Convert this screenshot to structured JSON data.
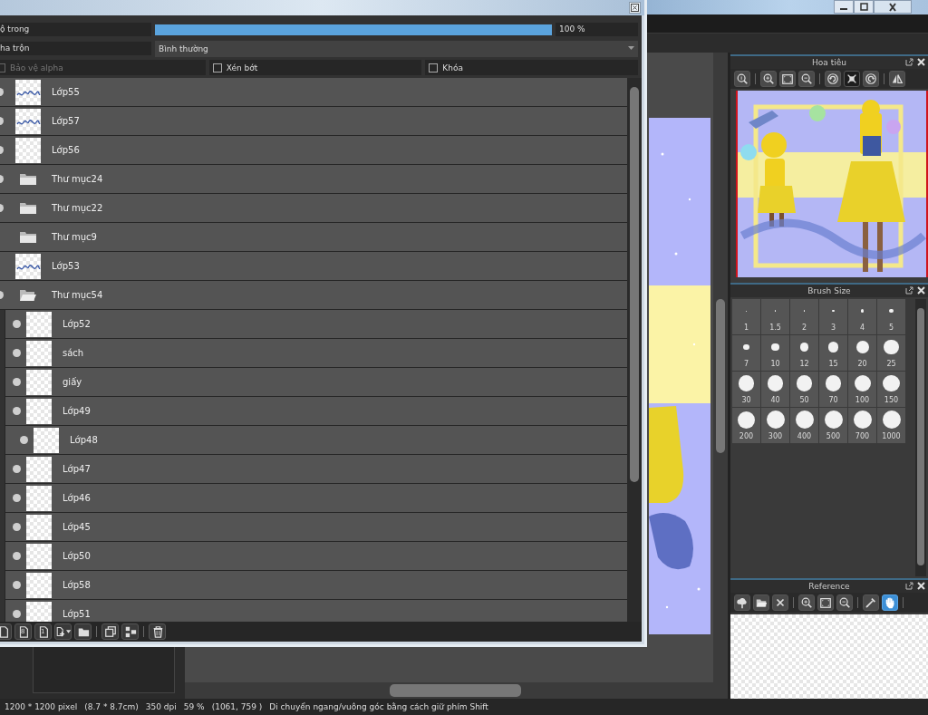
{
  "layer_panel": {
    "opacity": {
      "label": "ộ trong",
      "level": 1,
      "reading": "100 %"
    },
    "blend": {
      "label": "ha trộn",
      "value": "Bình thường"
    },
    "options": [
      {
        "label": "Bảo vệ alpha",
        "checked": false,
        "disabled": true
      },
      {
        "label": "Xén bớt",
        "checked": false,
        "disabled": false
      },
      {
        "label": "Khóa",
        "checked": false,
        "disabled": false
      }
    ],
    "layers": [
      {
        "kind": "layer",
        "name": "Lớp55",
        "visible": true,
        "thumbnail_drawn": true
      },
      {
        "kind": "layer",
        "name": "Lớp57",
        "visible": true,
        "thumbnail_drawn": true
      },
      {
        "kind": "layer",
        "name": "Lớp56",
        "visible": true,
        "thumbnail_drawn": false
      },
      {
        "kind": "folder",
        "name": "Thư mục24",
        "visible": true,
        "expanded": false
      },
      {
        "kind": "folder",
        "name": "Thư mục22",
        "visible": true,
        "expanded": false
      },
      {
        "kind": "folder",
        "name": "Thư mục9",
        "visible": false,
        "expanded": false
      },
      {
        "kind": "layer",
        "name": "Lớp53",
        "visible": false,
        "thumbnail_drawn": true
      },
      {
        "kind": "folder",
        "name": "Thư mục54",
        "visible": true,
        "expanded": true,
        "children": [
          {
            "kind": "layer",
            "name": "Lớp52",
            "visible": true,
            "thumbnail_drawn": false
          },
          {
            "kind": "layer",
            "name": "sách",
            "visible": true,
            "thumbnail_drawn": false
          },
          {
            "kind": "layer",
            "name": "giấy",
            "visible": true,
            "thumbnail_drawn": false
          },
          {
            "kind": "layer",
            "name": "Lớp49",
            "visible": true,
            "thumbnail_drawn": false
          },
          {
            "kind": "clipped",
            "name": "Lớp48",
            "visible": true,
            "thumbnail_drawn": false
          },
          {
            "kind": "layer",
            "name": "Lớp47",
            "visible": true,
            "thumbnail_drawn": false
          },
          {
            "kind": "layer",
            "name": "Lớp46",
            "visible": true,
            "thumbnail_drawn": false
          },
          {
            "kind": "layer",
            "name": "Lớp45",
            "visible": true,
            "thumbnail_drawn": false
          },
          {
            "kind": "layer",
            "name": "Lớp50",
            "visible": true,
            "thumbnail_drawn": false
          },
          {
            "kind": "layer",
            "name": "Lớp58",
            "visible": true,
            "thumbnail_drawn": false
          },
          {
            "kind": "layer",
            "name": "Lớp51",
            "visible": true,
            "thumbnail_drawn": false
          }
        ]
      }
    ],
    "toolbar": [
      {
        "kind": "new"
      },
      {
        "kind": "new-numbered",
        "glyph": "8"
      },
      {
        "kind": "new-numbered",
        "glyph": "1"
      },
      {
        "kind": "add-menu"
      },
      {
        "kind": "folder"
      },
      {
        "kind": "sep"
      },
      {
        "kind": "duplicate"
      },
      {
        "kind": "merge"
      },
      {
        "kind": "sep"
      },
      {
        "kind": "delete"
      }
    ]
  },
  "navigator": {
    "title": "Hoa tiêu",
    "tools": [
      {
        "kind": "zoom-reset",
        "selected": false
      },
      {
        "kind": "sep"
      },
      {
        "kind": "zoom-in",
        "selected": false
      },
      {
        "kind": "fit",
        "selected": false
      },
      {
        "kind": "zoom-out",
        "selected": false
      },
      {
        "kind": "sep"
      },
      {
        "kind": "rotate-left",
        "selected": false
      },
      {
        "kind": "fit-window",
        "selected": true
      },
      {
        "kind": "rotate-right",
        "selected": false
      },
      {
        "kind": "sep"
      },
      {
        "kind": "flip",
        "selected": false
      }
    ]
  },
  "brush_size": {
    "title": "Brush Size",
    "sizes": [
      "1",
      "1.5",
      "2",
      "3",
      "4",
      "5",
      "7",
      "10",
      "12",
      "15",
      "20",
      "25",
      "30",
      "40",
      "50",
      "70",
      "100",
      "150",
      "200",
      "300",
      "400",
      "500",
      "700",
      "1000"
    ]
  },
  "reference": {
    "title": "Reference",
    "tools": [
      {
        "kind": "upload",
        "selected": false
      },
      {
        "kind": "open",
        "selected": false
      },
      {
        "kind": "close",
        "selected": false
      },
      {
        "kind": "sep"
      },
      {
        "kind": "zoom-in",
        "selected": false
      },
      {
        "kind": "fit",
        "selected": false
      },
      {
        "kind": "zoom-out",
        "selected": false
      },
      {
        "kind": "sep"
      },
      {
        "kind": "eyedropper",
        "selected": false
      },
      {
        "kind": "hand",
        "selected": true
      },
      {
        "kind": "sep"
      }
    ]
  },
  "status_bar": [
    "1200 * 1200 pixel",
    "(8.7 * 8.7cm)",
    "350 dpi",
    "59 %",
    "(1061, 759 )",
    "Di chuyển ngang/vuông góc bằng cách giữ phím Shift"
  ]
}
